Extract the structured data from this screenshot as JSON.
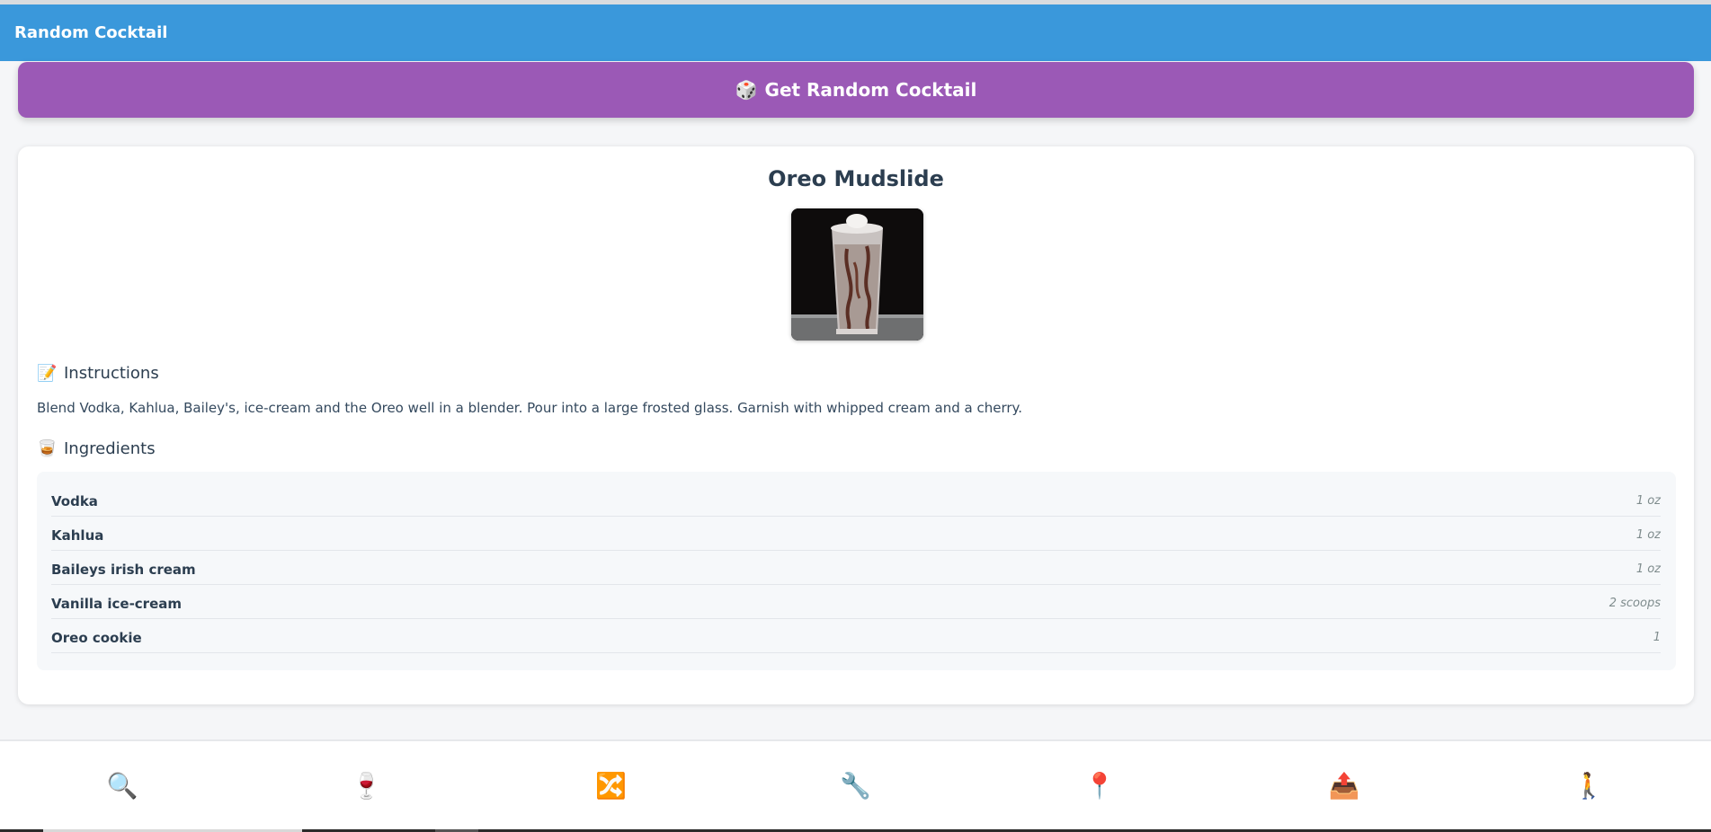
{
  "app": {
    "title": "Random Cocktail"
  },
  "actions": {
    "random_label": "Get Random Cocktail",
    "random_icon": "🎲"
  },
  "drink": {
    "name": "Oreo Mudslide",
    "image_alt": "Oreo Mudslide",
    "instructions_heading": "Instructions",
    "instructions_icon": "📝",
    "instructions": "Blend Vodka, Kahlua, Bailey's, ice-cream and the Oreo well in a blender. Pour into a large frosted glass. Garnish with whipped cream and a cherry.",
    "ingredients_heading": "Ingredients",
    "ingredients_icon": "🥃",
    "ingredients": [
      {
        "name": "Vodka",
        "measure": "1 oz"
      },
      {
        "name": "Kahlua",
        "measure": "1 oz"
      },
      {
        "name": "Baileys irish cream",
        "measure": "1 oz"
      },
      {
        "name": "Vanilla ice-cream",
        "measure": "2 scoops"
      },
      {
        "name": "Oreo cookie",
        "measure": "1"
      }
    ]
  },
  "nav": {
    "items": [
      {
        "icon": "🔍",
        "icon_name": "search-icon"
      },
      {
        "icon": "🍷",
        "icon_name": "wine-glass-icon"
      },
      {
        "icon": "🔀",
        "icon_name": "shuffle-icon"
      },
      {
        "icon": "🔧",
        "icon_name": "wrench-icon"
      },
      {
        "icon": "📍",
        "icon_name": "pin-icon"
      },
      {
        "icon": "📤",
        "icon_name": "outbox-icon"
      },
      {
        "icon": "🚶",
        "icon_name": "walking-person-icon"
      }
    ]
  },
  "colors": {
    "header": "#3a98db",
    "button": "#9b59b6",
    "text": "#2c3e50"
  }
}
